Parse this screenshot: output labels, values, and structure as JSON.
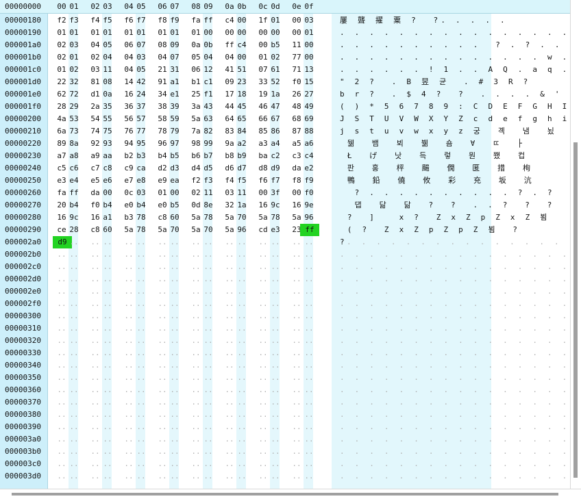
{
  "header": {
    "address": "00000000",
    "columns": [
      "00",
      "01",
      "02",
      "03",
      "04",
      "05",
      "06",
      "07",
      "08",
      "09",
      "0a",
      "0b",
      "0c",
      "0d",
      "0e",
      "0f"
    ]
  },
  "rows": [
    {
      "addr": "00000180",
      "hex": [
        "f2",
        "f3",
        "f4",
        "f5",
        "f6",
        "f7",
        "f8",
        "f9",
        "fa",
        "ff",
        "c4",
        "00",
        "1f",
        "01",
        "00",
        "03"
      ],
      "ascii": "屢 聾 擢 粟 ?  ?. . . . ."
    },
    {
      "addr": "00000190",
      "hex": [
        "01",
        "01",
        "01",
        "01",
        "01",
        "01",
        "01",
        "01",
        "01",
        "00",
        "00",
        "00",
        "00",
        "00",
        "00",
        "01"
      ],
      "ascii": ". . . . . . . . . . . . . . . ."
    },
    {
      "addr": "000001a0",
      "hex": [
        "02",
        "03",
        "04",
        "05",
        "06",
        "07",
        "08",
        "09",
        "0a",
        "0b",
        "ff",
        "c4",
        "00",
        "b5",
        "11",
        "00"
      ],
      "ascii": ". . . . . . . . . .  ? . ? . ."
    },
    {
      "addr": "000001b0",
      "hex": [
        "02",
        "01",
        "02",
        "04",
        "04",
        "03",
        "04",
        "07",
        "05",
        "04",
        "04",
        "00",
        "01",
        "02",
        "77",
        "00"
      ],
      "ascii": ". . . . . . . . . . . . . . w ."
    },
    {
      "addr": "000001c0",
      "hex": [
        "01",
        "02",
        "03",
        "11",
        "04",
        "05",
        "21",
        "31",
        "06",
        "12",
        "41",
        "51",
        "07",
        "61",
        "71",
        "13"
      ],
      "ascii": ". . . . . . ! 1 . . A Q . a q ."
    },
    {
      "addr": "000001d0",
      "hex": [
        "22",
        "32",
        "81",
        "08",
        "14",
        "42",
        "91",
        "a1",
        "b1",
        "c1",
        "09",
        "23",
        "33",
        "52",
        "f0",
        "15"
      ],
      "ascii": "\" 2 ?  . B 昱 균  . # 3 R ?"
    },
    {
      "addr": "000001e0",
      "hex": [
        "62",
        "72",
        "d1",
        "0a",
        "16",
        "24",
        "34",
        "e1",
        "25",
        "f1",
        "17",
        "18",
        "19",
        "1a",
        "26",
        "27"
      ],
      "ascii": "b r ?  . $ 4 ?  ?  . . . . & '"
    },
    {
      "addr": "000001f0",
      "hex": [
        "28",
        "29",
        "2a",
        "35",
        "36",
        "37",
        "38",
        "39",
        "3a",
        "43",
        "44",
        "45",
        "46",
        "47",
        "48",
        "49"
      ],
      "ascii": "( ) * 5 6 7 8 9 : C D E F G H I"
    },
    {
      "addr": "00000200",
      "hex": [
        "4a",
        "53",
        "54",
        "55",
        "56",
        "57",
        "58",
        "59",
        "5a",
        "63",
        "64",
        "65",
        "66",
        "67",
        "68",
        "69"
      ],
      "ascii": "J S T U V W X Y Z c d e f g h i"
    },
    {
      "addr": "00000210",
      "hex": [
        "6a",
        "73",
        "74",
        "75",
        "76",
        "77",
        "78",
        "79",
        "7a",
        "82",
        "83",
        "84",
        "85",
        "86",
        "87",
        "88"
      ],
      "ascii": "j s t u v w x y z 궁  곅  냄  뇠"
    },
    {
      "addr": "00000220",
      "hex": [
        "89",
        "8a",
        "92",
        "93",
        "94",
        "95",
        "96",
        "97",
        "98",
        "99",
        "9a",
        "a2",
        "a3",
        "a4",
        "a5",
        "a6"
      ],
      "ascii": " 뒒  뱀  뵈  뷂  숌  ∀  ㄸ  ├"
    },
    {
      "addr": "00000230",
      "hex": [
        "a7",
        "a8",
        "a9",
        "aa",
        "b2",
        "b3",
        "b4",
        "b5",
        "b6",
        "b7",
        "b8",
        "b9",
        "ba",
        "c2",
        "c3",
        "c4"
      ],
      "ascii": " Ł  げ  낫  득  렇  뭔  쬈  컵"
    },
    {
      "addr": "00000240",
      "hex": [
        "c5",
        "c6",
        "c7",
        "c8",
        "c9",
        "ca",
        "d2",
        "d3",
        "d4",
        "d5",
        "d6",
        "d7",
        "d8",
        "d9",
        "da",
        "e2"
      ],
      "ascii": " 판  홍  枰  颺  僩  匽  措  栒"
    },
    {
      "addr": "00000250",
      "hex": [
        "e3",
        "e4",
        "e5",
        "e6",
        "e7",
        "e8",
        "e9",
        "ea",
        "f2",
        "f3",
        "f4",
        "f5",
        "f6",
        "f7",
        "f8",
        "f9"
      ],
      "ascii": " 鴨  鉛  僥  攸  彩  充  坂  沆"
    },
    {
      "addr": "00000260",
      "hex": [
        "fa",
        "ff",
        "da",
        "00",
        "0c",
        "03",
        "01",
        "00",
        "02",
        "11",
        "03",
        "11",
        "00",
        "3f",
        "00",
        "f0"
      ],
      "ascii": "  ? . . . . . . . . . . ? . ?"
    },
    {
      "addr": "00000270",
      "hex": [
        "20",
        "b4",
        "f0",
        "b4",
        "e0",
        "b4",
        "e0",
        "b5",
        "0d",
        "8e",
        "32",
        "1a",
        "16",
        "9c",
        "16",
        "9e"
      ],
      "ascii": "  댑  닮  닮  ?  ?  . . ?  ?  ?"
    },
    {
      "addr": "00000280",
      "hex": [
        "16",
        "9c",
        "16",
        "a1",
        "b3",
        "78",
        "c8",
        "60",
        "5a",
        "78",
        "5a",
        "70",
        "5a",
        "78",
        "5a",
        "96"
      ],
      "ascii": " ?  ]   x ?  Z x Z p Z x Z 뵘"
    },
    {
      "addr": "00000290",
      "hex": [
        "ce",
        "28",
        "c8",
        "60",
        "5a",
        "78",
        "5a",
        "70",
        "5a",
        "70",
        "5a",
        "96",
        "cd",
        "e3",
        "23",
        "ff"
      ],
      "ascii": " ( ?  Z x Z p Z p Z 뵘  ?"
    },
    {
      "addr": "000002a0",
      "hex": [
        "d9"
      ],
      "ascii": "?"
    },
    {
      "addr": "000002b0",
      "hex": [],
      "ascii": ""
    },
    {
      "addr": "000002c0",
      "hex": [],
      "ascii": ""
    },
    {
      "addr": "000002d0",
      "hex": [],
      "ascii": ""
    },
    {
      "addr": "000002e0",
      "hex": [],
      "ascii": ""
    },
    {
      "addr": "000002f0",
      "hex": [],
      "ascii": ""
    },
    {
      "addr": "00000300",
      "hex": [],
      "ascii": ""
    },
    {
      "addr": "00000310",
      "hex": [],
      "ascii": ""
    },
    {
      "addr": "00000320",
      "hex": [],
      "ascii": ""
    },
    {
      "addr": "00000330",
      "hex": [],
      "ascii": ""
    },
    {
      "addr": "00000340",
      "hex": [],
      "ascii": ""
    },
    {
      "addr": "00000350",
      "hex": [],
      "ascii": ""
    },
    {
      "addr": "00000360",
      "hex": [],
      "ascii": ""
    },
    {
      "addr": "00000370",
      "hex": [],
      "ascii": ""
    },
    {
      "addr": "00000380",
      "hex": [],
      "ascii": ""
    },
    {
      "addr": "00000390",
      "hex": [],
      "ascii": ""
    },
    {
      "addr": "000003a0",
      "hex": [],
      "ascii": ""
    },
    {
      "addr": "000003b0",
      "hex": [],
      "ascii": ""
    },
    {
      "addr": "000003c0",
      "hex": [],
      "ascii": ""
    },
    {
      "addr": "000003d0",
      "hex": [],
      "ascii": ""
    }
  ],
  "selection": {
    "bytes": [
      "ff",
      "d9"
    ]
  },
  "empty_hex": "..",
  "empty_ascii": ". . . . . . . . . . . . . . . .",
  "colors": {
    "address_bg": "#cdeffa",
    "header_bg": "#d9f5fb",
    "stripe": "#e4f7fc",
    "selection": "#22d322"
  }
}
